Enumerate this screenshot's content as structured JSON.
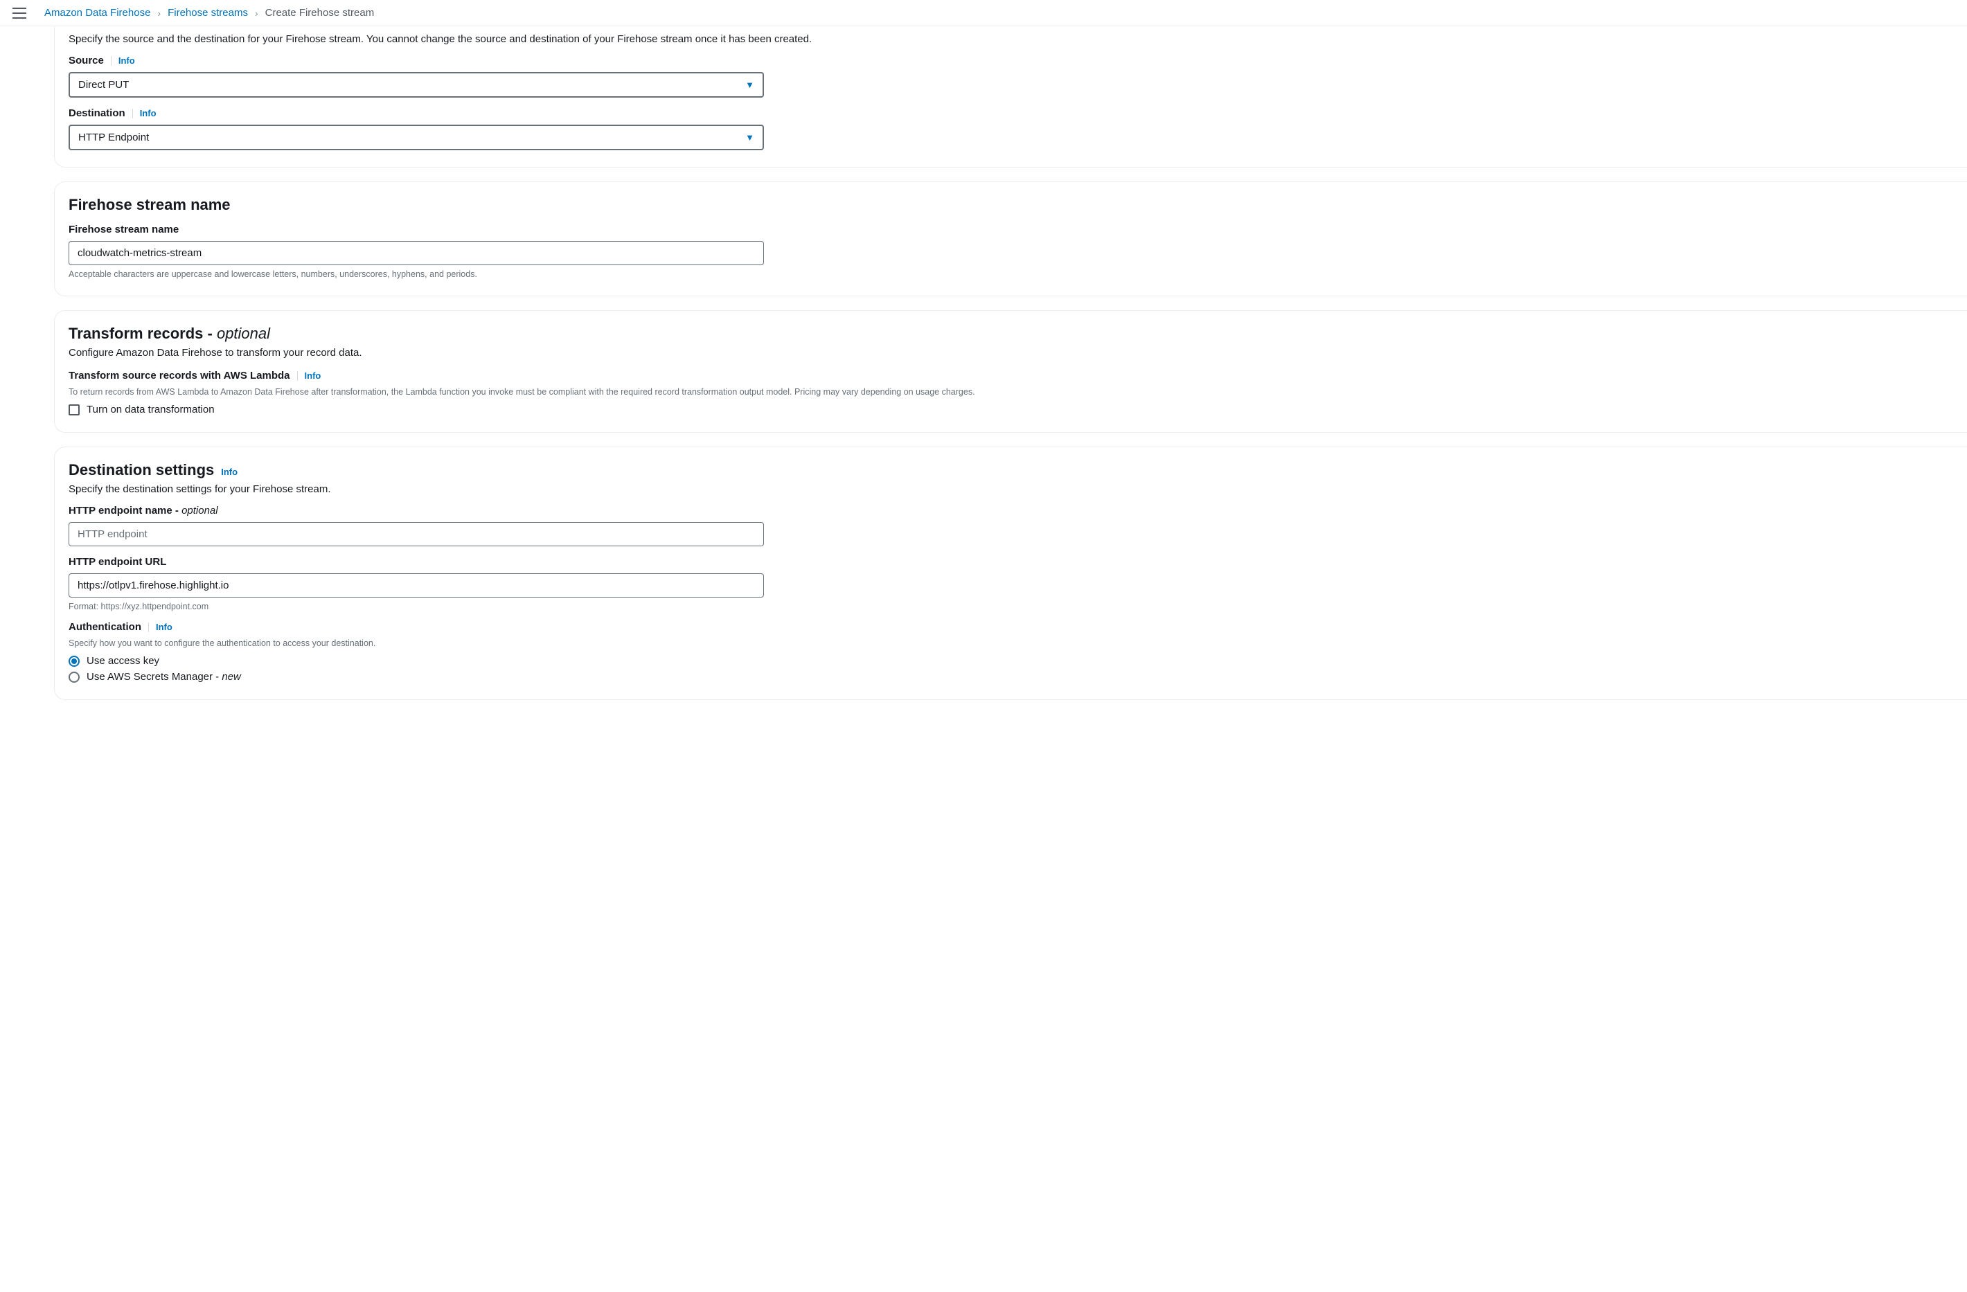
{
  "breadcrumbs": {
    "items": [
      "Amazon Data Firehose",
      "Firehose streams",
      "Create Firehose stream"
    ]
  },
  "panel_source_dest": {
    "description": "Specify the source and the destination for your Firehose stream. You cannot change the source and destination of your Firehose stream once it has been created.",
    "source_label": "Source",
    "source_value": "Direct PUT",
    "destination_label": "Destination",
    "destination_value": "HTTP Endpoint",
    "info": "Info"
  },
  "panel_name": {
    "title": "Firehose stream name",
    "label": "Firehose stream name",
    "value": "cloudwatch-metrics-stream",
    "hint": "Acceptable characters are uppercase and lowercase letters, numbers, underscores, hyphens, and periods."
  },
  "panel_transform": {
    "title_prefix": "Transform records - ",
    "title_optional": "optional",
    "subtitle": "Configure Amazon Data Firehose to transform your record data.",
    "lambda_heading": "Transform source records with AWS Lambda",
    "lambda_hint": "To return records from AWS Lambda to Amazon Data Firehose after transformation, the Lambda function you invoke must be compliant with the required record transformation output model. Pricing may vary depending on usage charges.",
    "checkbox_label": "Turn on data transformation",
    "info": "Info"
  },
  "panel_dest_settings": {
    "title": "Destination settings",
    "info": "Info",
    "subtitle": "Specify the destination settings for your Firehose stream.",
    "endpoint_name_label_prefix": "HTTP endpoint name - ",
    "endpoint_name_label_optional": "optional",
    "endpoint_name_placeholder": "HTTP endpoint",
    "endpoint_name_value": "",
    "endpoint_url_label": "HTTP endpoint URL",
    "endpoint_url_value": "https://otlpv1.firehose.highlight.io",
    "endpoint_url_hint": "Format: https://xyz.httpendpoint.com",
    "auth_heading": "Authentication",
    "auth_subtitle": "Specify how you want to configure the authentication to access your destination.",
    "auth_option1": "Use access key",
    "auth_option2_prefix": "Use AWS Secrets Manager - ",
    "auth_option2_new": "new"
  }
}
